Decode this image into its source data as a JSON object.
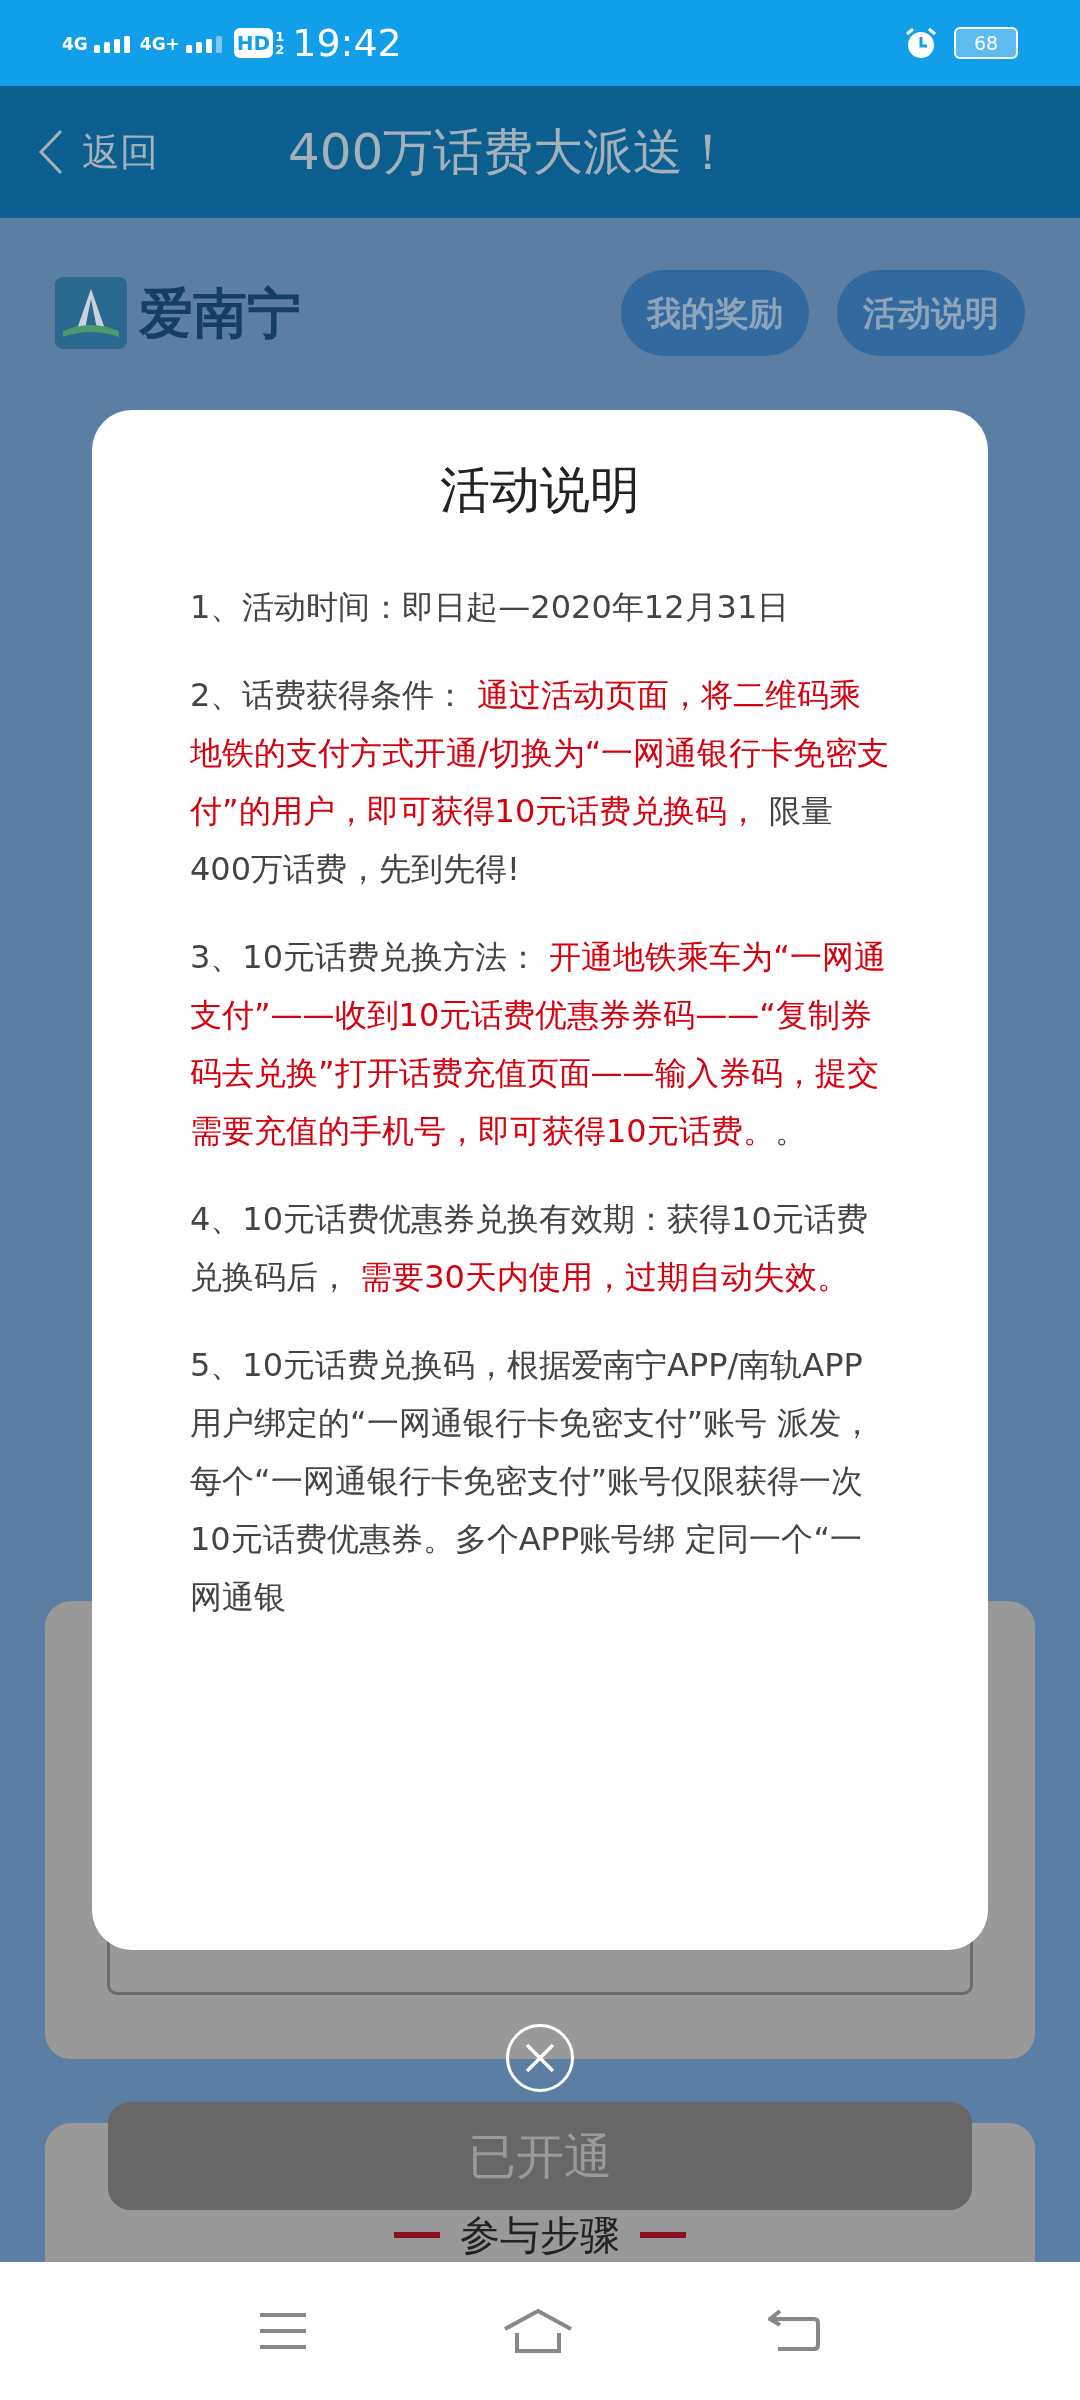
{
  "status_bar": {
    "network_1": "4G",
    "network_2": "4G+",
    "hd_label": "HD",
    "hd_slots": [
      "1",
      "2"
    ],
    "time": "19:42",
    "battery": "68"
  },
  "header": {
    "back_label": "返回",
    "title": "400万话费大派送！"
  },
  "brand": {
    "name": "爱南宁"
  },
  "top_buttons": [
    "我的奖励",
    "活动说明"
  ],
  "modal": {
    "title": "活动说明",
    "paragraphs": [
      {
        "segments": [
          {
            "kind": "plain",
            "text": "1、活动时间：即日起—2020年12月31日"
          }
        ]
      },
      {
        "segments": [
          {
            "kind": "plain",
            "text": "2、话费获得条件： "
          },
          {
            "kind": "highlight",
            "text": "通过活动页面，将二维码乘地铁的支付方式开通/切换为“一网通银行卡免密支付”的用户，即可获得10元话费兑换码，"
          },
          {
            "kind": "plain",
            "text": " 限量400万话费，先到先得!"
          }
        ]
      },
      {
        "segments": [
          {
            "kind": "plain",
            "text": "3、10元话费兑换方法： "
          },
          {
            "kind": "highlight",
            "text": "开通地铁乘车为“一网通支付”——收到10元话费优惠券券码——“复制券码去兑换”打开话费充值页面——输入券码，提交需要充值的手机号，即可获得10元话费。"
          },
          {
            "kind": "plain",
            "text": "。"
          }
        ]
      },
      {
        "segments": [
          {
            "kind": "plain",
            "text": "4、10元话费优惠券兑换有效期：获得10元话费兑换码后，"
          },
          {
            "kind": "highlight",
            "text": " 需要30天内使用，过期自动失效。"
          }
        ]
      },
      {
        "segments": [
          {
            "kind": "plain",
            "text": "5、10元话费兑换码，根据爱南宁APP/南轨APP用户绑定的“一网通银行卡免密支付”账号 派发，每个“一网通银行卡免密支付”账号仅限获得一次10元话费优惠券。多个APP账号绑 定同一个“一网通银"
          }
        ]
      }
    ]
  },
  "main_button": {
    "label": "已开通",
    "disabled": true
  },
  "section_heading": "参与步骤"
}
